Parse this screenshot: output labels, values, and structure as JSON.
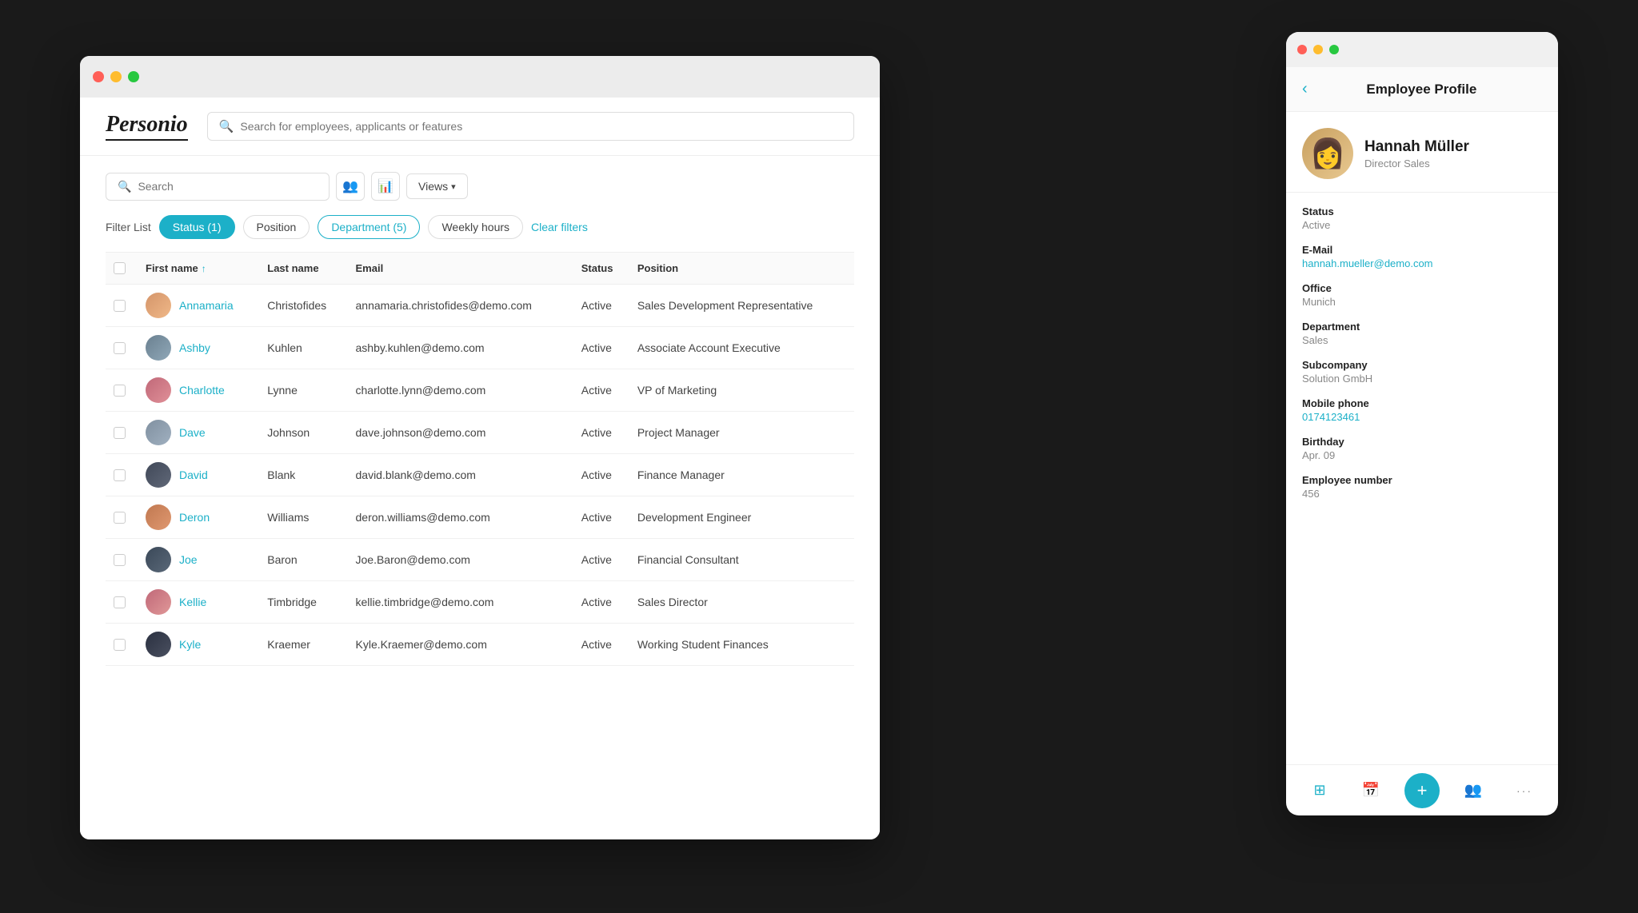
{
  "mainWindow": {
    "trafficLights": [
      "red",
      "yellow",
      "green"
    ],
    "logo": "Personio",
    "globalSearch": {
      "placeholder": "Search for employees, applicants or features"
    },
    "localSearch": {
      "placeholder": "Search"
    },
    "viewsButton": "Views",
    "filterList": {
      "label": "Filter List",
      "chips": [
        {
          "id": "status",
          "label": "Status (1)",
          "active": true
        },
        {
          "id": "position",
          "label": "Position",
          "active": false
        },
        {
          "id": "department",
          "label": "Department (5)",
          "active": true,
          "style": "outline"
        },
        {
          "id": "weekly-hours",
          "label": "Weekly hours",
          "active": false
        },
        {
          "id": "clear",
          "label": "Clear filters",
          "type": "link"
        }
      ]
    },
    "table": {
      "columns": [
        "",
        "First name",
        "Last name",
        "Email",
        "Status",
        "Position"
      ],
      "rows": [
        {
          "id": "annamaria",
          "firstName": "Annamaria",
          "lastName": "Christofides",
          "email": "annamaria.christofides@demo.com",
          "status": "Active",
          "position": "Sales Development Representative",
          "avatarClass": "av-annamaria"
        },
        {
          "id": "ashby",
          "firstName": "Ashby",
          "lastName": "Kuhlen",
          "email": "ashby.kuhlen@demo.com",
          "status": "Active",
          "position": "Associate Account Executive",
          "avatarClass": "av-ashby"
        },
        {
          "id": "charlotte",
          "firstName": "Charlotte",
          "lastName": "Lynne",
          "email": "charlotte.lynn@demo.com",
          "status": "Active",
          "position": "VP of Marketing",
          "avatarClass": "av-charlotte"
        },
        {
          "id": "dave",
          "firstName": "Dave",
          "lastName": "Johnson",
          "email": "dave.johnson@demo.com",
          "status": "Active",
          "position": "Project Manager",
          "avatarClass": "av-dave"
        },
        {
          "id": "david",
          "firstName": "David",
          "lastName": "Blank",
          "email": "david.blank@demo.com",
          "status": "Active",
          "position": "Finance Manager",
          "avatarClass": "av-david"
        },
        {
          "id": "deron",
          "firstName": "Deron",
          "lastName": "Williams",
          "email": "deron.williams@demo.com",
          "status": "Active",
          "position": "Development Engineer",
          "avatarClass": "av-deron"
        },
        {
          "id": "joe",
          "firstName": "Joe",
          "lastName": "Baron",
          "email": "Joe.Baron@demo.com",
          "status": "Active",
          "position": "Financial Consultant",
          "avatarClass": "av-joe"
        },
        {
          "id": "kellie",
          "firstName": "Kellie",
          "lastName": "Timbridge",
          "email": "kellie.timbridge@demo.com",
          "status": "Active",
          "position": "Sales Director",
          "avatarClass": "av-kellie"
        },
        {
          "id": "kyle",
          "firstName": "Kyle",
          "lastName": "Kraemer",
          "email": "Kyle.Kraemer@demo.com",
          "status": "Active",
          "position": "Working Student Finances",
          "avatarClass": "av-kyle"
        }
      ]
    }
  },
  "profilePanel": {
    "title": "Employee Profile",
    "backLabel": "‹",
    "employee": {
      "name": "Hannah Müller",
      "jobTitle": "Director Sales",
      "avatarEmoji": "👩‍💼"
    },
    "fields": [
      {
        "label": "Status",
        "value": "Active",
        "link": false
      },
      {
        "label": "E-Mail",
        "value": "hannah.mueller@demo.com",
        "link": true
      },
      {
        "label": "Office",
        "value": "Munich",
        "link": false
      },
      {
        "label": "Department",
        "value": "Sales",
        "link": false
      },
      {
        "label": "Subcompany",
        "value": "Solution GmbH",
        "link": false
      },
      {
        "label": "Mobile phone",
        "value": "0174123461",
        "link": true
      },
      {
        "label": "Birthday",
        "value": "Apr. 09",
        "link": false
      },
      {
        "label": "Employee number",
        "value": "456",
        "link": false
      }
    ],
    "navIcons": [
      {
        "id": "grid",
        "symbol": "⊞",
        "active": true
      },
      {
        "id": "calendar",
        "symbol": "📅",
        "active": false
      },
      {
        "id": "add",
        "symbol": "+",
        "primary": true
      },
      {
        "id": "people",
        "symbol": "👥",
        "active": false
      },
      {
        "id": "more",
        "symbol": "···",
        "active": false
      }
    ]
  }
}
